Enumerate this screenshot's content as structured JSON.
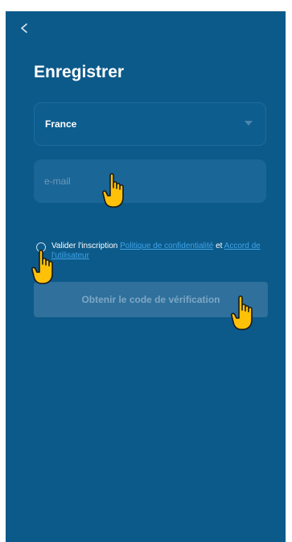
{
  "header": {
    "back_icon": "chevron-left-icon",
    "title": "Enregistrer"
  },
  "form": {
    "country": {
      "value": "France",
      "icon": "caret-down-icon"
    },
    "email": {
      "placeholder": "e-mail",
      "value": ""
    },
    "agreement": {
      "checked": false,
      "prefix": "Valider l'inscription",
      "privacy_link": "Politique de confidentialité",
      "conjunction": "et",
      "user_agreement_link": "Accord de l'utilisateur"
    },
    "submit_label": "Obtenir le code de vérification"
  },
  "overlays": {
    "pointer_icon": "hand-pointer-icon"
  },
  "colors": {
    "background": "#0c5a8a",
    "field": "#1a6696",
    "button": "#2f709c",
    "link": "#3fa3e6",
    "pointer": "#ffc107"
  }
}
